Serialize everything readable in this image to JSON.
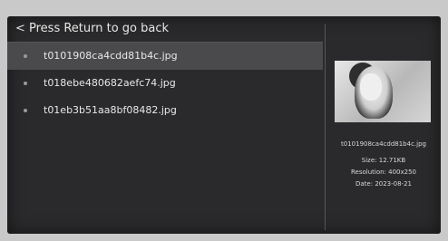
{
  "header": {
    "back_glyph": "<",
    "title": "Press Return to go back"
  },
  "files": [
    {
      "name": "t0101908ca4cdd81b4c.jpg",
      "selected": true
    },
    {
      "name": "t018ebe480682aefc74.jpg",
      "selected": false
    },
    {
      "name": "t01eb3b51aa8bf08482.jpg",
      "selected": false
    }
  ],
  "info": {
    "filename": "t0101908ca4cdd81b4c.jpg",
    "size": "Size:  12.71KB",
    "resolution": "Resolution:  400x250",
    "date": "Date:  2023-08-21"
  },
  "colors": {
    "screen_background": "#2a2a2c",
    "selected_row": "#4a4a4c",
    "text": "#e8e8e8"
  }
}
